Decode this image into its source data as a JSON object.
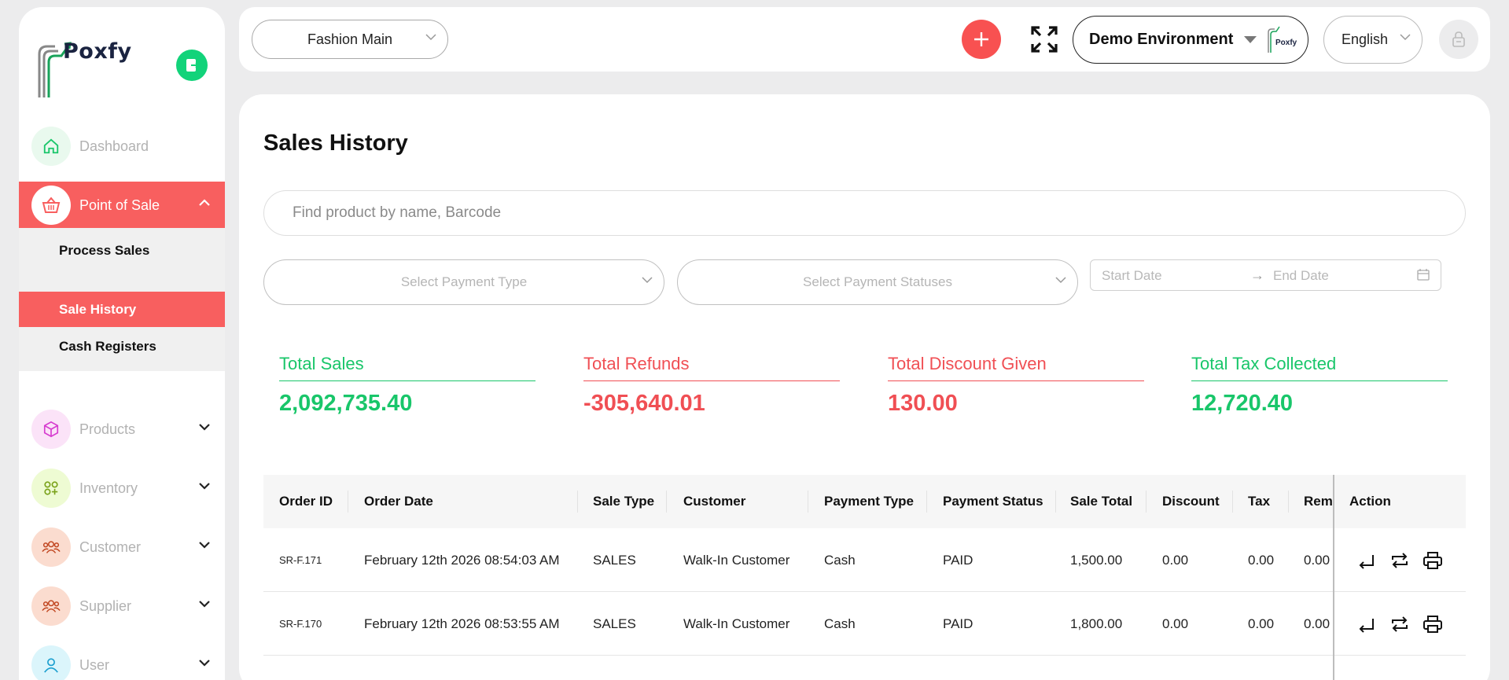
{
  "sidebar": {
    "brand": "Poxfy",
    "items": [
      {
        "label": "Dashboard"
      },
      {
        "label": "Point of Sale"
      },
      {
        "label": "Products"
      },
      {
        "label": "Inventory"
      },
      {
        "label": "Customer"
      },
      {
        "label": "Supplier"
      },
      {
        "label": "User"
      }
    ],
    "submenu": [
      {
        "label": "Process Sales"
      },
      {
        "label": "Sale History"
      },
      {
        "label": "Cash Registers"
      }
    ]
  },
  "header": {
    "store": "Fashion Main",
    "environment": "Demo Environment",
    "env_logo_text": "Poxfy",
    "language": "English"
  },
  "main": {
    "title": "Sales History",
    "search_placeholder": "Find product by name, Barcode",
    "filters": {
      "payment_type": "Select Payment Type",
      "payment_status": "Select Payment Statuses",
      "start_date": "Start Date",
      "end_date": "End Date"
    },
    "stats": [
      {
        "title": "Total Sales",
        "value": "2,092,735.40"
      },
      {
        "title": "Total Refunds",
        "value": "-305,640.01"
      },
      {
        "title": "Total Discount Given",
        "value": "130.00"
      },
      {
        "title": "Total Tax Collected",
        "value": "12,720.40"
      }
    ],
    "table": {
      "headers": [
        "Order ID",
        "Order Date",
        "Sale Type",
        "Customer",
        "Payment Type",
        "Payment Status",
        "Sale Total",
        "Discount",
        "Tax",
        "Rem",
        "Action"
      ],
      "rows": [
        [
          "SR-F.171",
          "February 12th 2026 08:54:03 AM",
          "SALES",
          "Walk-In Customer",
          "Cash",
          "PAID",
          "1,500.00",
          "0.00",
          "0.00",
          "0.00"
        ],
        [
          "SR-F.170",
          "February 12th 2026 08:53:55 AM",
          "SALES",
          "Walk-In Customer",
          "Cash",
          "PAID",
          "1,800.00",
          "0.00",
          "0.00",
          "0.00"
        ]
      ]
    }
  },
  "colors": {
    "accent_red": "#f85f5f",
    "accent_green": "#19c66a",
    "refund_red": "#f04f54"
  }
}
